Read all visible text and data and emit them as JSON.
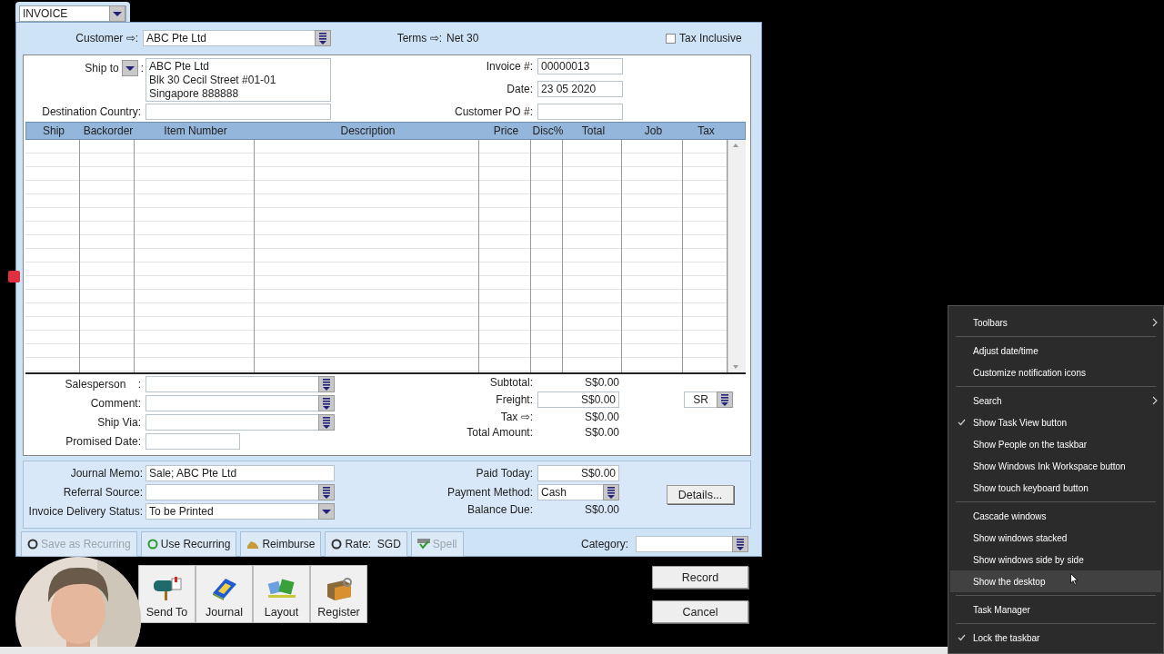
{
  "document_type": {
    "value": "INVOICE"
  },
  "header": {
    "customer_label": "Customer ⇨:",
    "customer": "ABC Pte Ltd",
    "terms_label": "Terms ⇨:",
    "terms": "Net 30",
    "tax_inclusive": {
      "label": "Tax Inclusive",
      "checked": false
    }
  },
  "ship_to": {
    "label": "Ship to",
    "colon": ":",
    "address": [
      "ABC Pte Ltd",
      "Blk 30 Cecil Street #01-01",
      "Singapore 888888"
    ]
  },
  "destination_country": {
    "label": "Destination Country:"
  },
  "invoice_fields": [
    {
      "label": "Invoice #:",
      "value": "00000013"
    },
    {
      "label": "Date:",
      "value": "23 05 2020"
    },
    {
      "label": "Customer PO #:"
    }
  ],
  "table": {
    "columns": [
      "Ship",
      "Backorder",
      "Item Number",
      "Description",
      "Price",
      "Disc%",
      "Total",
      "Job",
      "Tax"
    ]
  },
  "details_fields": [
    {
      "label": "Salesperson    :",
      "kind": "list"
    },
    {
      "label": "Comment:",
      "kind": "list"
    },
    {
      "label": "Ship Via:",
      "kind": "list"
    },
    {
      "label": "Promised Date:",
      "kind": "short"
    }
  ],
  "totals": [
    {
      "label": "Subtotal:",
      "value": "S$0.00",
      "kind": "text"
    },
    {
      "label": "Freight:",
      "value": "S$0.00",
      "kind": "field",
      "tax_code": "SR"
    },
    {
      "label": "Tax ⇨:",
      "value": "S$0.00",
      "kind": "text"
    },
    {
      "label": "Total Amount:",
      "value": "S$0.00",
      "kind": "text"
    }
  ],
  "payment_left": [
    {
      "label": "Journal Memo:",
      "value": "Sale; ABC Pte Ltd",
      "kind": "field"
    },
    {
      "label": "Referral Source:",
      "kind": "list"
    },
    {
      "label": "Invoice Delivery Status:",
      "value": "To be Printed",
      "kind": "dropdown"
    }
  ],
  "payment_right": [
    {
      "label": "Paid Today:",
      "value": "S$0.00",
      "kind": "field"
    },
    {
      "label": "Payment Method:",
      "value": "Cash",
      "kind": "list"
    },
    {
      "label": "Balance Due:",
      "value": "S$0.00",
      "kind": "text"
    }
  ],
  "details_button": "Details...",
  "action_buttons": [
    {
      "label": "Save as Recurring",
      "kind": "recurring",
      "disabled": true
    },
    {
      "label": "Use Recurring",
      "kind": "use-recurring",
      "disabled": false
    },
    {
      "label": "Reimburse",
      "kind": "reimburse",
      "disabled": false
    },
    {
      "label": "Rate:  SGD",
      "kind": "rate",
      "disabled": false
    },
    {
      "label": "Spell",
      "kind": "spell",
      "disabled": true
    }
  ],
  "category": {
    "label": "Category:"
  },
  "toolbar": [
    {
      "label": "Send To",
      "kind": "mailbox"
    },
    {
      "label": "Journal",
      "kind": "journal"
    },
    {
      "label": "Layout",
      "kind": "layout"
    },
    {
      "label": "Register",
      "kind": "register"
    }
  ],
  "record_button": "Record",
  "cancel_button": "Cancel",
  "context_menu": {
    "items": [
      {
        "kind": "item",
        "label": "Toolbars",
        "checked": false,
        "submenu": true,
        "selected": false
      },
      {
        "kind": "separator"
      },
      {
        "kind": "item",
        "label": "Adjust date/time",
        "checked": false,
        "submenu": false,
        "selected": false
      },
      {
        "kind": "item",
        "label": "Customize notification icons",
        "checked": false,
        "submenu": false,
        "selected": false
      },
      {
        "kind": "separator"
      },
      {
        "kind": "item",
        "label": "Search",
        "checked": false,
        "submenu": true,
        "selected": false
      },
      {
        "kind": "item",
        "label": "Show Task View button",
        "checked": true,
        "submenu": false,
        "selected": false
      },
      {
        "kind": "item",
        "label": "Show People on the taskbar",
        "checked": false,
        "submenu": false,
        "selected": false
      },
      {
        "kind": "item",
        "label": "Show Windows Ink Workspace button",
        "checked": false,
        "submenu": false,
        "selected": false
      },
      {
        "kind": "item",
        "label": "Show touch keyboard button",
        "checked": false,
        "submenu": false,
        "selected": false
      },
      {
        "kind": "separator"
      },
      {
        "kind": "item",
        "label": "Cascade windows",
        "checked": false,
        "submenu": false,
        "selected": false
      },
      {
        "kind": "item",
        "label": "Show windows stacked",
        "checked": false,
        "submenu": false,
        "selected": false
      },
      {
        "kind": "item",
        "label": "Show windows side by side",
        "checked": false,
        "submenu": false,
        "selected": false
      },
      {
        "kind": "item",
        "label": "Show the desktop",
        "checked": false,
        "submenu": false,
        "selected": true
      },
      {
        "kind": "separator"
      },
      {
        "kind": "item",
        "label": "Task Manager",
        "checked": false,
        "submenu": false,
        "selected": false
      },
      {
        "kind": "separator"
      },
      {
        "kind": "item",
        "label": "Lock the taskbar",
        "checked": true,
        "submenu": false,
        "selected": false
      }
    ]
  }
}
